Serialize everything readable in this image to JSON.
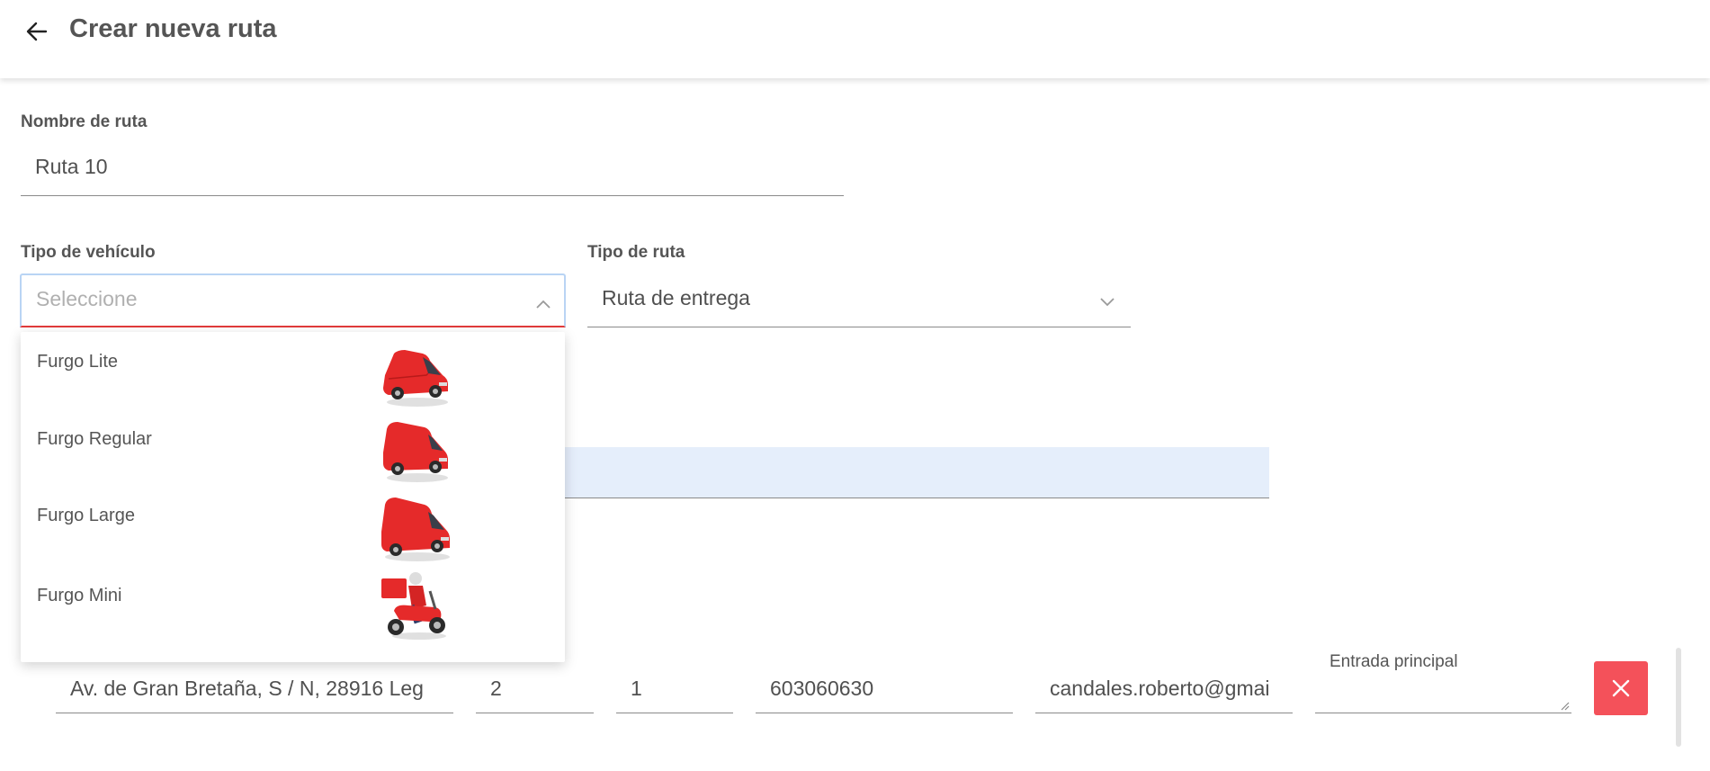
{
  "header": {
    "title": "Crear nueva ruta"
  },
  "route_name": {
    "label": "Nombre de ruta",
    "value": "Ruta 10"
  },
  "vehicle_type": {
    "label": "Tipo de vehículo",
    "placeholder": "Seleccione",
    "options": [
      {
        "label": "Furgo Lite",
        "icon": "small-red-van"
      },
      {
        "label": "Furgo Regular",
        "icon": "red-van"
      },
      {
        "label": "Furgo Large",
        "icon": "large-red-van"
      },
      {
        "label": "Furgo Mini",
        "icon": "red-delivery-scooter"
      }
    ]
  },
  "route_type": {
    "label": "Tipo de ruta",
    "value": "Ruta de entrega"
  },
  "stop_row": {
    "address": "Av. de Gran Bretaña, S / N, 28916 Leg",
    "field2": "2",
    "field3": "1",
    "phone": "603060630",
    "email": "candales.roberto@gmai",
    "notes": "Entrada principal"
  },
  "colors": {
    "accent_red": "#f4515a",
    "focus_blue": "#b9d4f4",
    "van_red": "#e52a2a"
  }
}
